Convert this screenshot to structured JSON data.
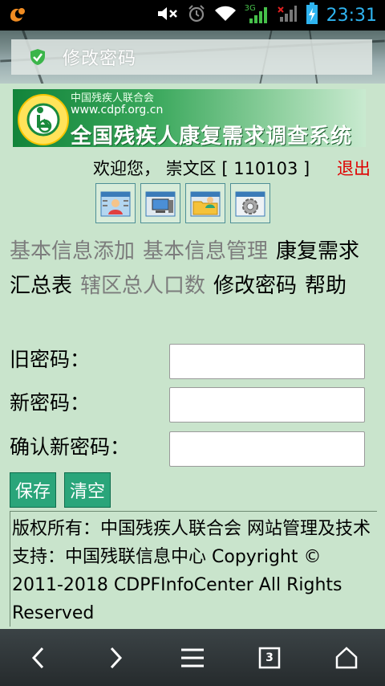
{
  "status_bar": {
    "time": "23:31",
    "network": "3G",
    "icons": [
      "uc-browser-icon",
      "mute-icon",
      "alarm-icon",
      "wifi-icon",
      "signal-icon",
      "battery-charging-icon"
    ]
  },
  "page": {
    "title": "修改密码"
  },
  "banner": {
    "org_name": "中国残疾人联合会",
    "url": "www.cdpf.org.cn",
    "system_name": "全国残疾人康复需求调查系统"
  },
  "welcome": {
    "text": "欢迎您， 崇文区 [ 110103 ]",
    "logout": "退出"
  },
  "toolbar_icons": [
    "user-add-icon",
    "computer-manage-icon",
    "folder-user-icon",
    "settings-gear-icon"
  ],
  "nav": {
    "items": [
      {
        "label": "基本信息添加",
        "active": false
      },
      {
        "label": "基本信息管理",
        "active": false
      },
      {
        "label": "康复需求汇总表",
        "active": true
      },
      {
        "label": "辖区总人口数",
        "active": false
      },
      {
        "label": "修改密码",
        "active": true
      },
      {
        "label": "帮助",
        "active": true
      }
    ]
  },
  "form": {
    "old_password_label": "旧密码：",
    "new_password_label": "新密码：",
    "confirm_password_label": "确认新密码：",
    "old_password_value": "",
    "new_password_value": "",
    "confirm_password_value": "",
    "save_label": "保存",
    "clear_label": "清空"
  },
  "footer": {
    "text": "版权所有：中国残疾人联合会 网站管理及技术支持：中国残联信息中心 Copyright © 2011-2018 CDPFInfoCenter All Rights Reserved"
  },
  "browser_nav": {
    "tab_count": "3",
    "icons": [
      "back-icon",
      "forward-icon",
      "menu-icon",
      "tabs-icon",
      "home-icon"
    ]
  },
  "colors": {
    "page_background": "#c9e4cc",
    "button": "#2aa57a",
    "logout": "#e00000",
    "time": "#2fb4f0"
  }
}
